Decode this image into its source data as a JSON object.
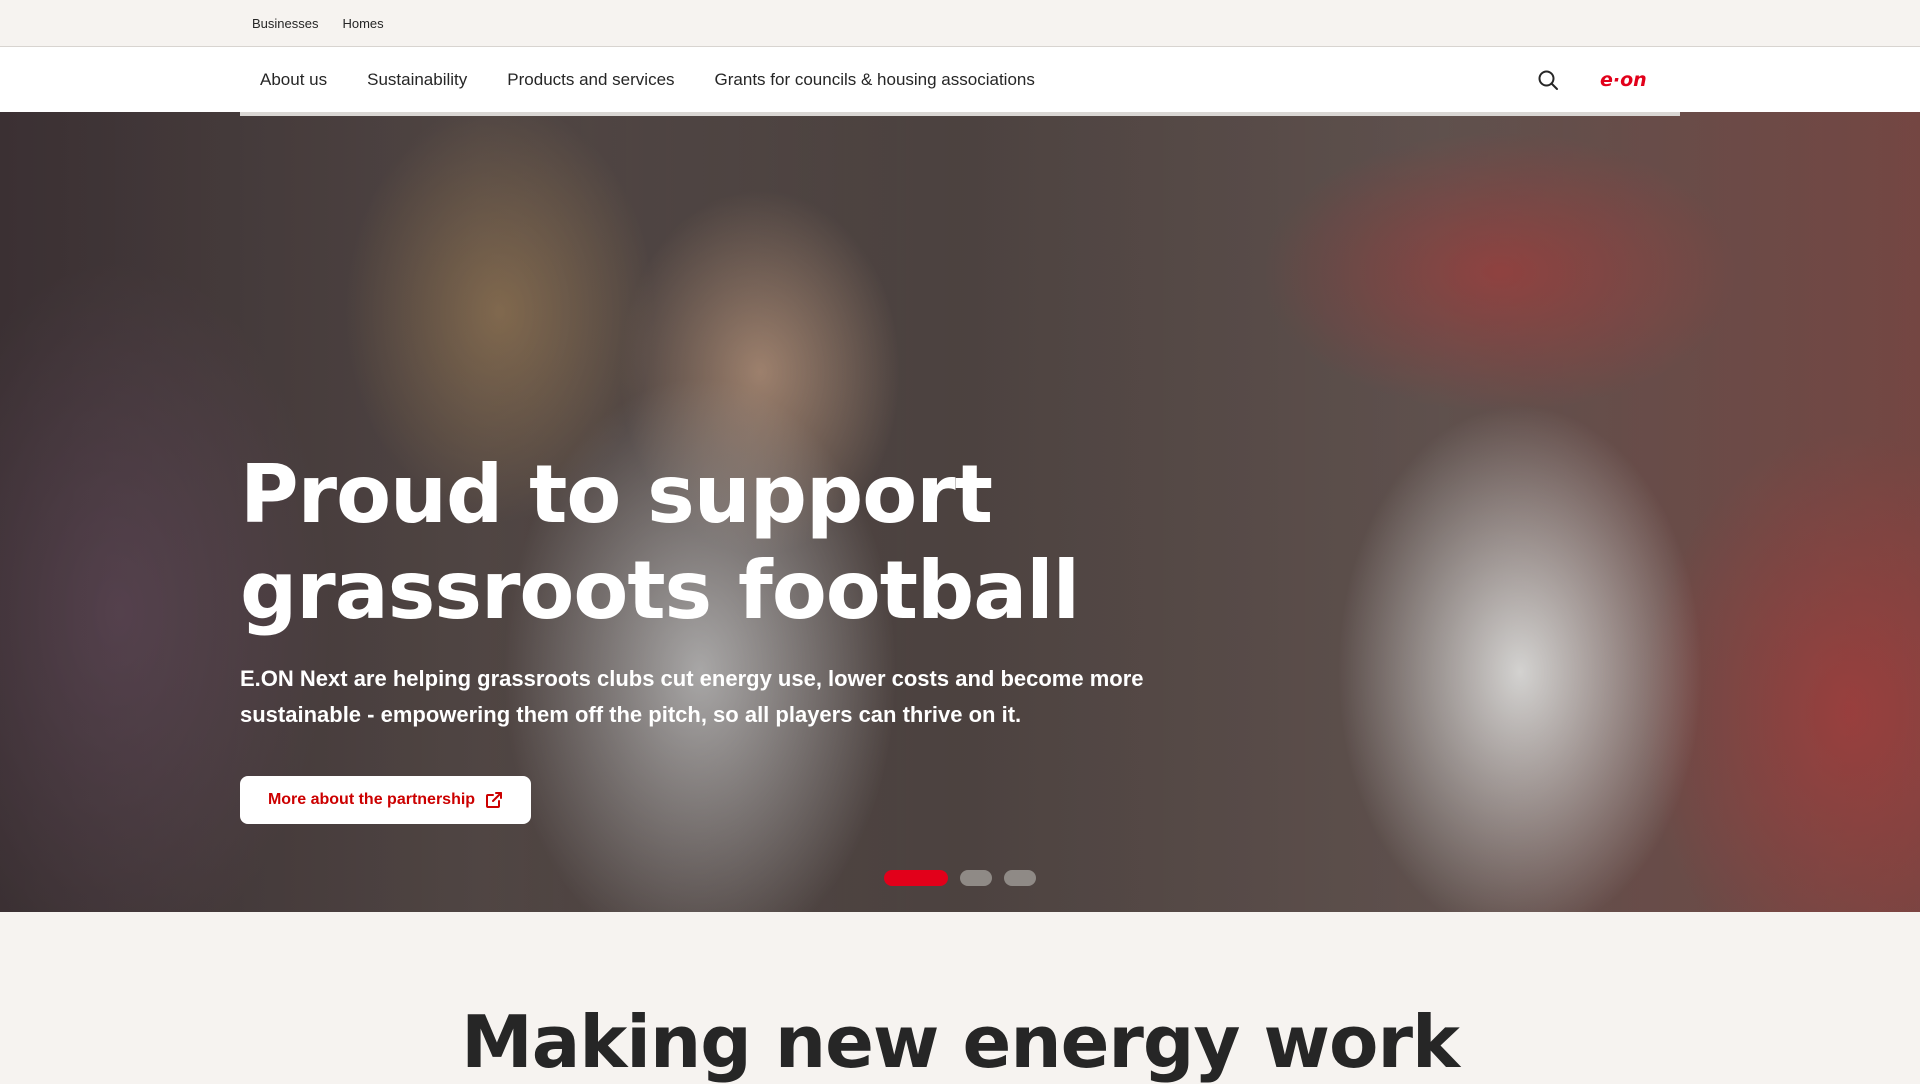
{
  "utility_nav": {
    "items": [
      "Businesses",
      "Homes"
    ]
  },
  "main_nav": {
    "items": [
      "About us",
      "Sustainability",
      "Products and services",
      "Grants for councils & housing associations"
    ],
    "search_icon": "search-icon",
    "logo_text": "e·on"
  },
  "hero": {
    "title_line1": "Proud to support",
    "title_line2": "grassroots football",
    "text": "E.ON Next are helping grassroots clubs cut energy use, lower costs and become more sustainable - empowering them off the pitch, so all players can thrive on it.",
    "cta_label": "More about the partnership",
    "cta_icon": "external-link-icon",
    "carousel": {
      "total_slides": 3,
      "active_index": 0
    }
  },
  "section": {
    "title": "Making new energy work"
  },
  "colors": {
    "brand_red": "#e2001a",
    "cta_text": "#cc0000",
    "page_bg": "#f6f3f0"
  }
}
